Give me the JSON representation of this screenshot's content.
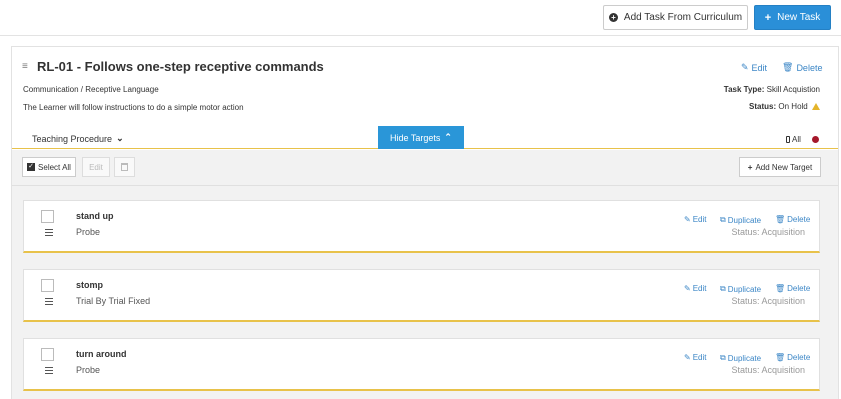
{
  "toolbar": {
    "add_from_curriculum": "Add Task From Curriculum",
    "new_task": "New Task"
  },
  "task": {
    "title": "RL-01 - Follows one-step receptive commands",
    "domain": "Communication / Receptive Language",
    "description": "The Learner will follow instructions to do a simple motor action",
    "edit": "Edit",
    "delete": "Delete",
    "task_type_label": "Task Type:",
    "task_type_value": "Skill Acquistion",
    "status_label": "Status:",
    "status_value": "On Hold"
  },
  "controls": {
    "teaching_procedure": "Teaching Procedure",
    "hide_targets": "Hide Targets",
    "all": "All"
  },
  "target_bar": {
    "select_all": "Select All",
    "edit": "Edit",
    "add_new_target": "Add New Target"
  },
  "targets": [
    {
      "name": "stand up",
      "type": "Probe",
      "edit": "Edit",
      "duplicate": "Duplicate",
      "delete": "Delete",
      "status": "Status: Acquisition"
    },
    {
      "name": "stomp",
      "type": "Trial By Trial Fixed",
      "edit": "Edit",
      "duplicate": "Duplicate",
      "delete": "Delete",
      "status": "Status: Acquisition"
    },
    {
      "name": "turn around",
      "type": "Probe",
      "edit": "Edit",
      "duplicate": "Duplicate",
      "delete": "Delete",
      "status": "Status: Acquisition"
    }
  ],
  "colors": {
    "accent": "#2a8fd8",
    "link": "#3b86c6",
    "divider": "#e8c24a",
    "warning": "#e4b42a",
    "indicator": "#a5182b"
  },
  "icons": {
    "curriculum": "plus-circle-icon",
    "new_task": "plus-icon",
    "drag": "drag-handle-icon",
    "edit": "edit-icon",
    "delete": "trash-icon",
    "duplicate": "duplicate-icon",
    "warning": "warning-icon",
    "chevron": "chevron-icon",
    "device": "phone-icon",
    "checkbox": "checkbox-icon"
  }
}
